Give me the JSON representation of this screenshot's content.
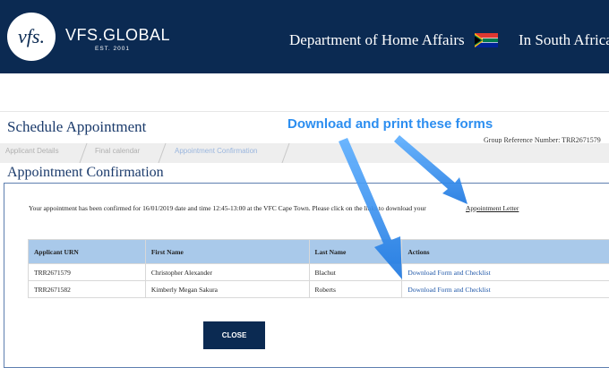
{
  "header": {
    "logo_text": "vfs.",
    "brand": "VFS.GLOBAL",
    "brand_est": "EST. 2001",
    "department": "Department of Home Affairs",
    "country": "In South Africa"
  },
  "schedule": {
    "title": "Schedule Appointment",
    "group_reference": "Group Reference Number: TRR2671579"
  },
  "steps": [
    {
      "label": "Applicant Details"
    },
    {
      "label": "Final calendar"
    },
    {
      "label": "Appointment Confirmation"
    }
  ],
  "confirmation": {
    "title": "Appointment Confirmation",
    "message": "Your appointment has been confirmed for 16/01/2019 date and time 12:45-13:00 at the VFC Cape Town. Please click on the links to download your",
    "letter_link": "Appointment Letter"
  },
  "table": {
    "columns": [
      "Applicant URN",
      "First Name",
      "Last Name",
      "Actions"
    ],
    "rows": [
      {
        "urn": "TRR2671579",
        "first": "Christopher Alexander",
        "last": "Blachut",
        "action": "Download Form and Checklist"
      },
      {
        "urn": "TRR2671582",
        "first": "Kimberly Megan Sakura",
        "last": "Roberts",
        "action": "Download Form and Checklist"
      }
    ]
  },
  "close_label": "CLOSE",
  "annotation": "Download and print these forms",
  "colors": {
    "header_bg": "#0b2a52",
    "table_header": "#a9c9ea",
    "link": "#1f57a8",
    "annotation": "#2c8ef0"
  }
}
